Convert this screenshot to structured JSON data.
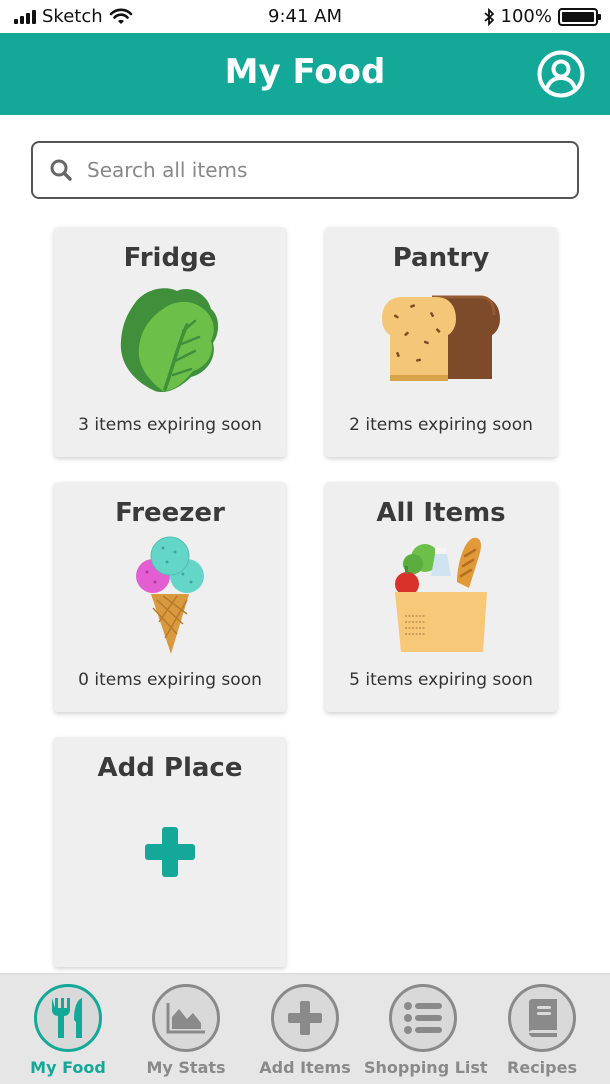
{
  "status_bar": {
    "carrier": "Sketch",
    "time": "9:41 AM",
    "battery": "100%"
  },
  "header": {
    "title": "My Food",
    "profile_icon": "user-circle-icon"
  },
  "search": {
    "placeholder": "Search all items",
    "value": ""
  },
  "places": [
    {
      "title": "Fridge",
      "subtitle": "3 items expiring soon",
      "icon": "lettuce-icon"
    },
    {
      "title": "Pantry",
      "subtitle": "2 items expiring soon",
      "icon": "bread-icon"
    },
    {
      "title": "Freezer",
      "subtitle": "0 items expiring soon",
      "icon": "ice-cream-icon"
    },
    {
      "title": "All Items",
      "subtitle": "5 items expiring soon",
      "icon": "grocery-bag-icon"
    },
    {
      "title": "Add Place",
      "icon": "plus-icon"
    }
  ],
  "bottom_nav": [
    {
      "label": "My Food",
      "icon": "fork-knife-icon",
      "active": true
    },
    {
      "label": "My Stats",
      "icon": "area-chart-icon",
      "active": false
    },
    {
      "label": "Add Items",
      "icon": "plus-icon",
      "active": false
    },
    {
      "label": "Shopping List",
      "icon": "list-icon",
      "active": false
    },
    {
      "label": "Recipes",
      "icon": "book-icon",
      "active": false
    }
  ],
  "colors": {
    "accent": "#14a898",
    "card_bg": "#efefef",
    "nav_bg": "#e6e6e6",
    "nav_inactive": "#8a8a8a"
  }
}
